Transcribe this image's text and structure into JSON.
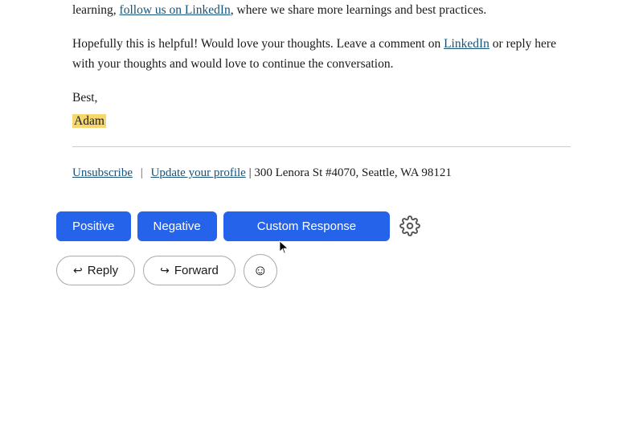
{
  "email": {
    "top_line": "learning, follow us on LinkedIn, where we share more learnings and best practices.",
    "top_link_text": "follow us on LinkedIn",
    "paragraph": "Hopefully this is helpful! Would love your thoughts. Leave a comment on LinkedIn or reply here with your thoughts and would love to continue the conversation.",
    "paragraph_link": "LinkedIn",
    "greeting": "Best,",
    "author_name": "Adam",
    "footer": {
      "unsubscribe_label": "Unsubscribe",
      "update_profile_label": "Update your profile",
      "address": "300 Lenora St #4070, Seattle, WA 98121"
    }
  },
  "actions": {
    "positive_label": "Positive",
    "negative_label": "Negative",
    "custom_response_label": "Custom Response",
    "reply_label": "Reply",
    "forward_label": "Forward"
  },
  "colors": {
    "button_blue": "#2563eb",
    "highlight_yellow": "#f5d76e",
    "link_color": "#1a5276"
  }
}
